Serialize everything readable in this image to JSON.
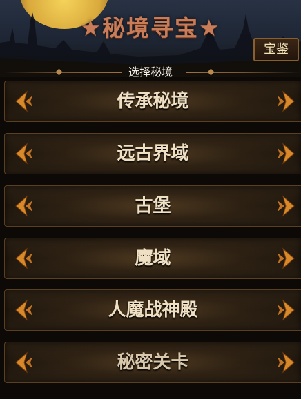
{
  "header": {
    "title": "★秘境寻宝★",
    "treasure_button": "宝鉴",
    "subtitle": "选择秘境"
  },
  "realms": [
    {
      "label": "传承秘境"
    },
    {
      "label": "远古界域"
    },
    {
      "label": "古堡"
    },
    {
      "label": "魔域"
    },
    {
      "label": "人魔战神殿"
    },
    {
      "label": "秘密关卡"
    }
  ],
  "colors": {
    "title": "#c87c58",
    "arrow": "#d88a2a",
    "row_text": "#efe0c4",
    "border": "#5a4020"
  },
  "icons": {
    "left_arrow": "chevron-left-icon",
    "right_arrow": "chevron-right-icon"
  }
}
